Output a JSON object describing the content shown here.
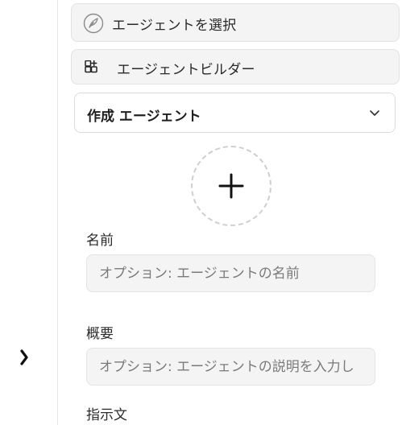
{
  "sidebar": {
    "select_agent_label": "エージェントを選択",
    "agent_builder_label": "エージェントビルダー"
  },
  "agent_dropdown": {
    "selected": "作成 エージェント"
  },
  "form": {
    "name_label": "名前",
    "name_placeholder": "オプション: エージェントの名前",
    "description_label": "概要",
    "description_placeholder": "オプション: エージェントの説明を入力し",
    "instructions_label": "指示文"
  },
  "icons": {
    "select_agent": "feather-icon",
    "agent_builder": "grid-plus-icon",
    "dropdown": "chevron-down-icon",
    "avatar_upload": "plus-icon",
    "rail_toggle": "chevron-right-icon"
  }
}
